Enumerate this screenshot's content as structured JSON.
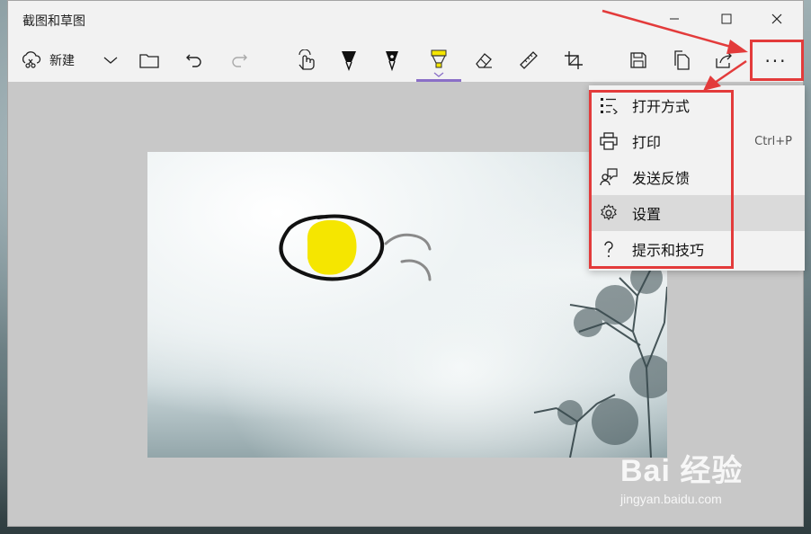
{
  "window": {
    "title": "截图和草图"
  },
  "window_controls": {
    "minimize": "–",
    "maximize": "☐",
    "close": "✕"
  },
  "toolbar": {
    "new_label": "新建",
    "more_label": "···",
    "selected_tool": "highlighter",
    "colors": {
      "pen_black": "#111111",
      "highlighter": "#f5e600",
      "accent_underline": "#8a6fc7"
    }
  },
  "menu": {
    "items": [
      {
        "label": "打开方式",
        "shortcut": "",
        "icon": "open-with-icon"
      },
      {
        "label": "打印",
        "shortcut": "Ctrl+P",
        "icon": "printer-icon"
      },
      {
        "label": "发送反馈",
        "shortcut": "",
        "icon": "feedback-icon"
      },
      {
        "label": "设置",
        "shortcut": "",
        "icon": "gear-icon"
      },
      {
        "label": "提示和技巧",
        "shortcut": "",
        "icon": "question-icon"
      }
    ]
  },
  "annotation": {
    "highlight_color": "#e33b3b"
  },
  "watermark": {
    "brand": "Bai 经验",
    "url": "jingyan.baidu.com"
  }
}
